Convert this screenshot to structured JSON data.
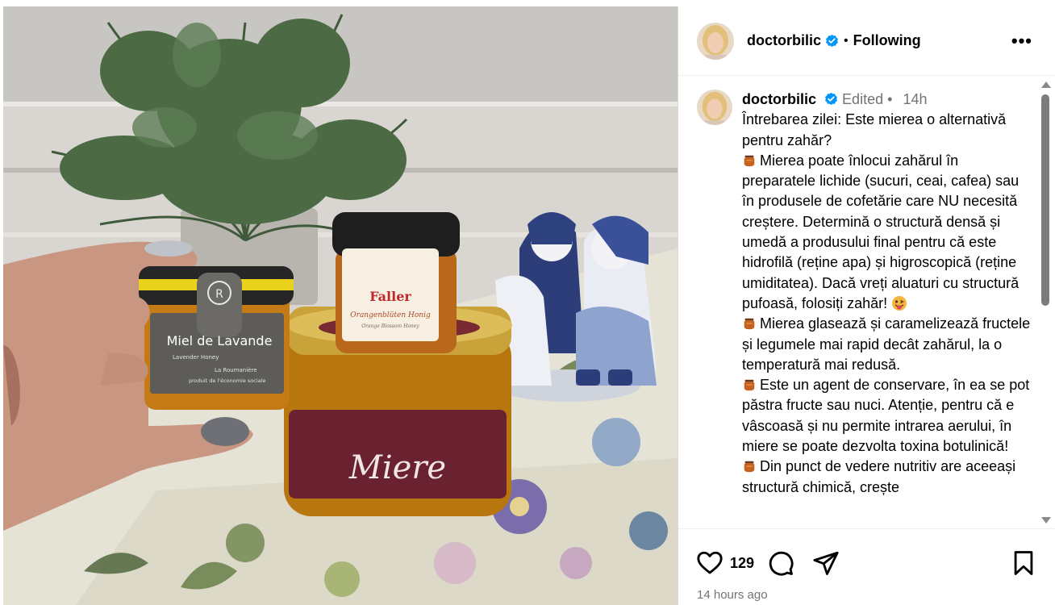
{
  "post": {
    "username": "doctorbilic",
    "follow_status": "Following",
    "separator": "•",
    "more_label": "•••"
  },
  "photo": {
    "jar_small_label": "Miel de Lavande",
    "jar_small_sub": "Lavender Honey",
    "jar_small_brand": "La Roumanière",
    "jar_small_note": "produit de l'économie sociale",
    "jar_small_logo": "R",
    "jar_mid_brand": "Faller",
    "jar_mid_label": "Orangenblüten Honig",
    "jar_mid_sub": "Orange Blossom Honey",
    "jar_big_label": "Miere"
  },
  "caption": {
    "username": "doctorbilic",
    "edited": "Edited",
    "dot": "•",
    "time_ago": "14h",
    "lines": {
      "intro": "Întrebarea zilei: Este mierea o alternativă pentru zahăr?",
      "p1": "Mierea poate înlocui zahărul în preparatele lichide (sucuri, ceai, cafea) sau în produsele de cofetărie care NU necesită creștere. Determină o structură densă și umedă a produsului final pentru că este hidrofilă (reține apa) și higroscopică (reține umiditatea). Dacă vreți aluaturi cu structură pufoasă, folosiți zahăr!",
      "p2": "Mierea glasează și caramelizează fructele și legumele mai rapid decât zahărul, la o temperatură mai redusă.",
      "p3": "Este un agent de conservare, în ea se pot păstra fructe sau nuci. Atenție, pentru că e vâscoasă și nu permite intrarea aerului, în miere se poate dezvolta toxina botulinică!",
      "p4": "Din punct de vedere nutritiv are aceeași structură chimică, crește"
    }
  },
  "actions": {
    "likes": "129",
    "timestamp": "14 hours ago"
  },
  "icons": {
    "bullet": "honey-pot-icon",
    "emoji": "tongue-face-emoji",
    "verified": "verified-badge-icon"
  },
  "colors": {
    "verified": "#0095f6",
    "meta_gray": "#737373",
    "scroll_thumb": "#7c7c7c"
  }
}
